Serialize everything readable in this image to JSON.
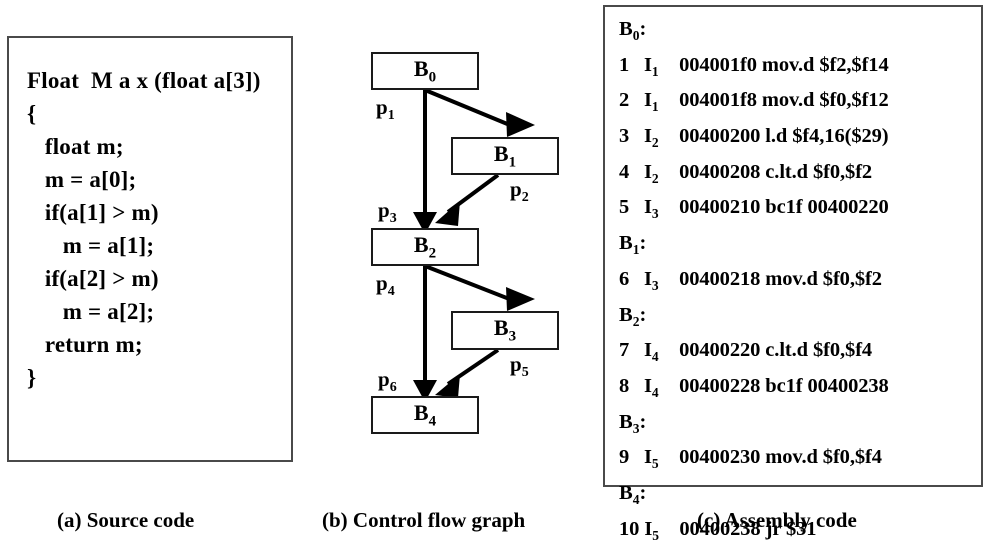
{
  "figure": {
    "captions": {
      "a": "(a) Source code",
      "b": "(b) Control flow graph",
      "c": "(c) Assembly code"
    }
  },
  "source_code": {
    "text": "Float  M a x (float a[3])\n{\n   float m;\n   m = a[0];\n   if(a[1] > m)\n      m = a[1];\n   if(a[2] > m)\n      m = a[2];\n   return m;\n}"
  },
  "cfg": {
    "nodes": [
      {
        "id": "B0",
        "label": "B",
        "sub": "0"
      },
      {
        "id": "B1",
        "label": "B",
        "sub": "1"
      },
      {
        "id": "B2",
        "label": "B",
        "sub": "2"
      },
      {
        "id": "B3",
        "label": "B",
        "sub": "3"
      },
      {
        "id": "B4",
        "label": "B",
        "sub": "4"
      }
    ],
    "edges": [
      {
        "id": "p1",
        "label": "p",
        "sub": "1",
        "from": "B0",
        "to": "B2"
      },
      {
        "id": "p2",
        "label": "p",
        "sub": "2",
        "from": "B1",
        "to": "B2"
      },
      {
        "id": "p3",
        "label": "p",
        "sub": "3",
        "from": "B0",
        "to": "B1"
      },
      {
        "id": "p4",
        "label": "p",
        "sub": "4",
        "from": "B2",
        "to": "B4"
      },
      {
        "id": "p5",
        "label": "p",
        "sub": "5",
        "from": "B3",
        "to": "B4"
      },
      {
        "id": "p6",
        "label": "p",
        "sub": "6",
        "from": "B2",
        "to": "B3"
      }
    ]
  },
  "assembly": {
    "blocks": [
      {
        "header": "B",
        "header_sub": "0",
        "instructions": [
          {
            "num": "1",
            "itag": "I",
            "itag_sub": "1",
            "address": "004001f0",
            "text": "mov.d $f2,$f14"
          },
          {
            "num": "2",
            "itag": "I",
            "itag_sub": "1",
            "address": "004001f8",
            "text": "mov.d $f0,$f12"
          },
          {
            "num": "3",
            "itag": "I",
            "itag_sub": "2",
            "address": "00400200",
            "text": "l.d $f4,16($29)"
          },
          {
            "num": "4",
            "itag": "I",
            "itag_sub": "2",
            "address": "00400208",
            "text": "c.lt.d $f0,$f2"
          },
          {
            "num": "5",
            "itag": "I",
            "itag_sub": "3",
            "address": "00400210",
            "text": "bc1f 00400220"
          }
        ]
      },
      {
        "header": "B",
        "header_sub": "1",
        "instructions": [
          {
            "num": "6",
            "itag": "I",
            "itag_sub": "3",
            "address": "00400218",
            "text": "mov.d $f0,$f2"
          }
        ]
      },
      {
        "header": "B",
        "header_sub": "2",
        "instructions": [
          {
            "num": "7",
            "itag": "I",
            "itag_sub": "4",
            "address": "00400220",
            "text": "c.lt.d $f0,$f4"
          },
          {
            "num": "8",
            "itag": "I",
            "itag_sub": "4",
            "address": "00400228",
            "text": "bc1f 00400238"
          }
        ]
      },
      {
        "header": "B",
        "header_sub": "3",
        "instructions": [
          {
            "num": "9",
            "itag": "I",
            "itag_sub": "5",
            "address": "00400230",
            "text": "mov.d $f0,$f4"
          }
        ]
      },
      {
        "header": "B",
        "header_sub": "4",
        "instructions": [
          {
            "num": "10",
            "itag": "I",
            "itag_sub": "5",
            "address": "00400238",
            "text": "jr $31"
          }
        ]
      }
    ]
  }
}
